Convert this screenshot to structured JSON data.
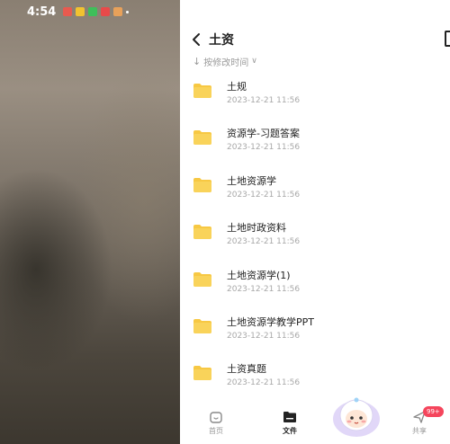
{
  "status_bar": {
    "time": "4:54"
  },
  "header": {
    "title": "土资"
  },
  "sort": {
    "label": "按修改时间"
  },
  "folders": [
    {
      "name": "土规",
      "modified": "2023-12-21  11:56"
    },
    {
      "name": "资源学-习题答案",
      "modified": "2023-12-21  11:56"
    },
    {
      "name": "土地资源学",
      "modified": "2023-12-21  11:56"
    },
    {
      "name": "土地时政资料",
      "modified": "2023-12-21  11:56"
    },
    {
      "name": "土地资源学(1)",
      "modified": "2023-12-21  11:56"
    },
    {
      "name": "土地资源学教学PPT",
      "modified": "2023-12-21  11:56"
    },
    {
      "name": "土资真题",
      "modified": "2023-12-21  11:56"
    }
  ],
  "tabbar": {
    "home": "首页",
    "files": "文件",
    "share": "共享",
    "share_badge": "99+"
  },
  "colors": {
    "folder": "#f7c843",
    "badge": "#f5455c"
  },
  "icons": {
    "back": "chevron-left-icon",
    "folder": "folder-icon",
    "home": "home-icon",
    "files": "folder-filled-icon",
    "share": "send-icon"
  }
}
